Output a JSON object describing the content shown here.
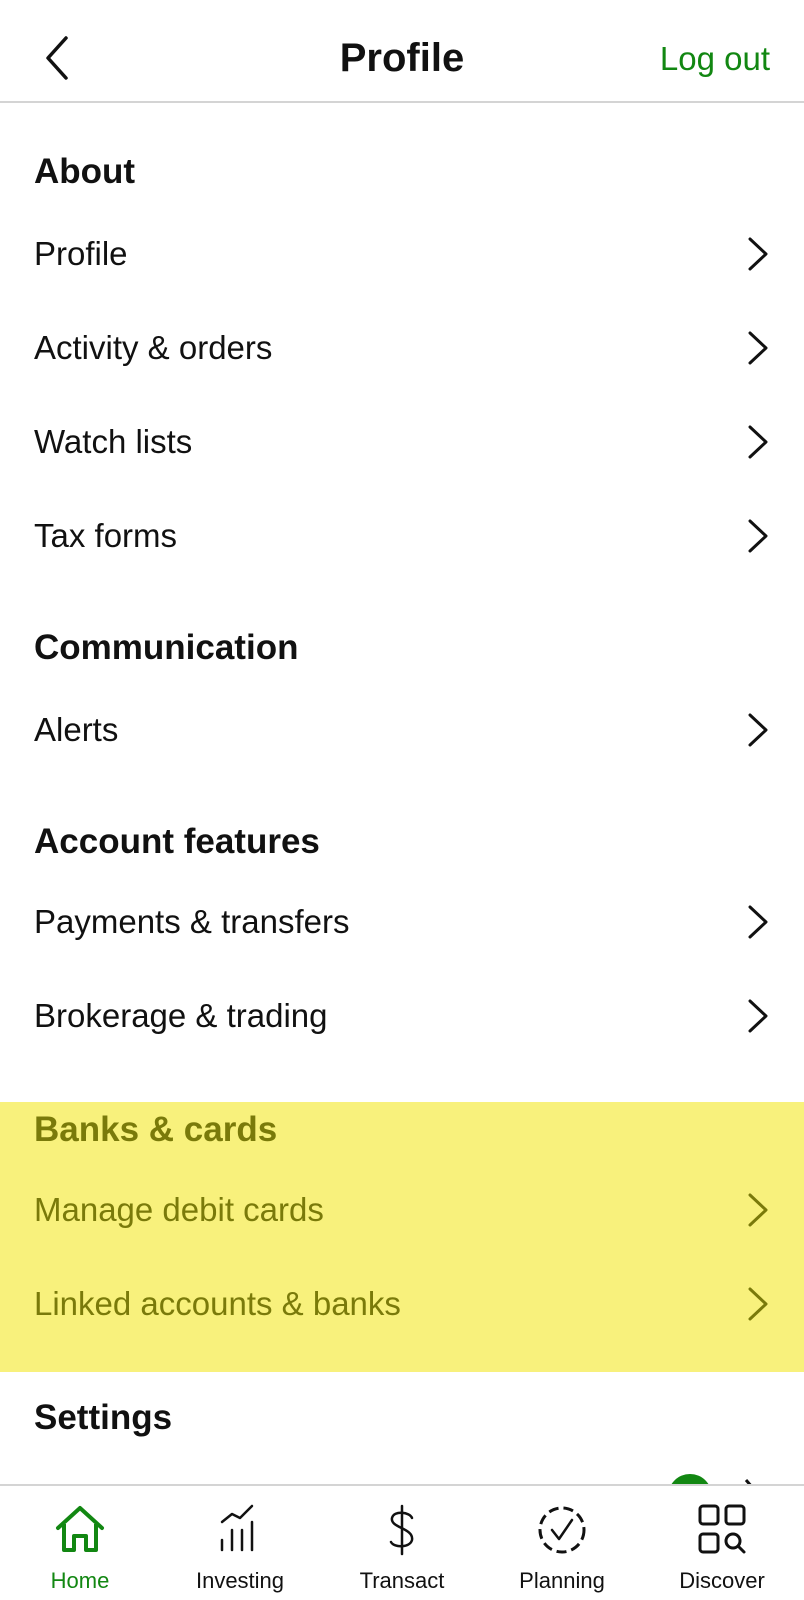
{
  "header": {
    "back_icon": "chevron-left-icon",
    "title": "Profile",
    "logout_label": "Log out"
  },
  "sections": [
    {
      "heading": "About",
      "items": [
        {
          "label": "Profile"
        },
        {
          "label": "Activity & orders"
        },
        {
          "label": "Watch lists"
        },
        {
          "label": "Tax forms"
        }
      ]
    },
    {
      "heading": "Communication",
      "items": [
        {
          "label": "Alerts"
        }
      ]
    },
    {
      "heading": "Account features",
      "items": [
        {
          "label": "Payments & transfers"
        },
        {
          "label": "Brokerage & trading"
        }
      ]
    },
    {
      "heading": "Banks & cards",
      "highlighted": true,
      "items": [
        {
          "label": "Manage debit cards"
        },
        {
          "label": "Linked accounts & banks"
        }
      ]
    },
    {
      "heading": "Settings",
      "items": []
    }
  ],
  "tabbar": {
    "active": "Home",
    "tabs": [
      {
        "label": "Home",
        "icon": "home-icon"
      },
      {
        "label": "Investing",
        "icon": "chart-icon"
      },
      {
        "label": "Transact",
        "icon": "dollar-icon"
      },
      {
        "label": "Planning",
        "icon": "check-circle-icon"
      },
      {
        "label": "Discover",
        "icon": "grid-search-icon"
      }
    ]
  },
  "colors": {
    "accent": "#128712",
    "highlight": "#f8f17c",
    "highlight_text": "#7a7a0a"
  }
}
